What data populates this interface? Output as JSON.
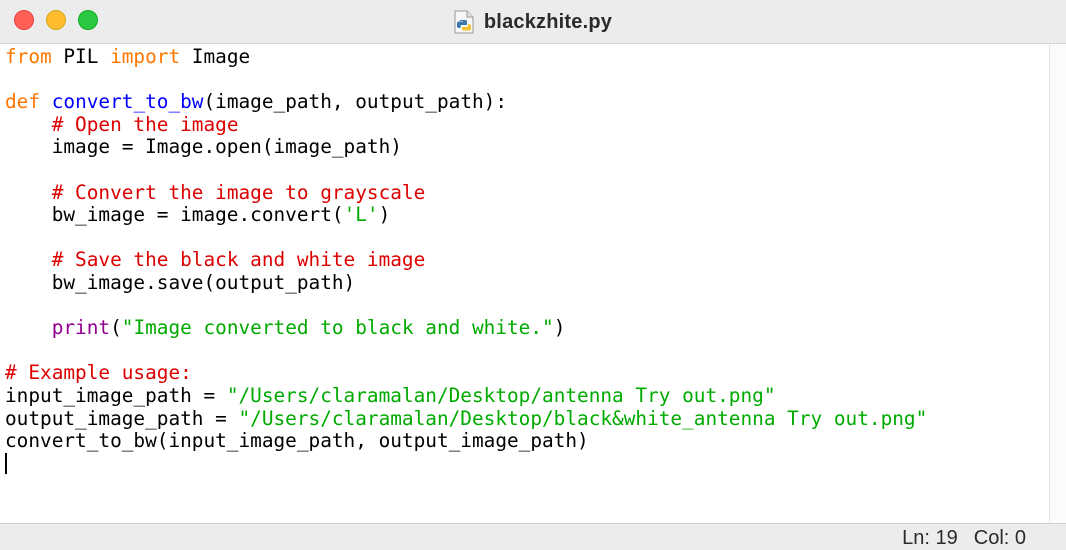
{
  "window": {
    "title": "blackzhite.py",
    "file_icon": "python-file-icon"
  },
  "editor": {
    "lines": [
      [
        {
          "t": "from",
          "c": "kw"
        },
        {
          "t": " PIL "
        },
        {
          "t": "import",
          "c": "kw"
        },
        {
          "t": " Image"
        }
      ],
      [],
      [
        {
          "t": "def",
          "c": "kw"
        },
        {
          "t": " "
        },
        {
          "t": "convert_to_bw",
          "c": "fn"
        },
        {
          "t": "(image_path, output_path):"
        }
      ],
      [
        {
          "t": "    "
        },
        {
          "t": "# Open the image",
          "c": "cm"
        }
      ],
      [
        {
          "t": "    image = Image.open(image_path)"
        }
      ],
      [],
      [
        {
          "t": "    "
        },
        {
          "t": "# Convert the image to grayscale",
          "c": "cm"
        }
      ],
      [
        {
          "t": "    bw_image = image.convert("
        },
        {
          "t": "'L'",
          "c": "st"
        },
        {
          "t": ")"
        }
      ],
      [],
      [
        {
          "t": "    "
        },
        {
          "t": "# Save the black and white image",
          "c": "cm"
        }
      ],
      [
        {
          "t": "    bw_image.save(output_path)"
        }
      ],
      [],
      [
        {
          "t": "    "
        },
        {
          "t": "print",
          "c": "bi"
        },
        {
          "t": "("
        },
        {
          "t": "\"Image converted to black and white.\"",
          "c": "st"
        },
        {
          "t": ")"
        }
      ],
      [],
      [
        {
          "t": "# Example usage:",
          "c": "cm"
        }
      ],
      [
        {
          "t": "input_image_path = "
        },
        {
          "t": "\"/Users/claramalan/Desktop/antenna Try out.png\"",
          "c": "st"
        }
      ],
      [
        {
          "t": "output_image_path = "
        },
        {
          "t": "\"/Users/claramalan/Desktop/black&white_antenna Try out.png\"",
          "c": "st"
        }
      ],
      [
        {
          "t": "convert_to_bw(input_image_path, output_image_path)"
        }
      ],
      []
    ],
    "cursor_line": 19
  },
  "status": {
    "line": "Ln: 19",
    "col": "Col: 0"
  },
  "colors": {
    "keyword": "#ff7700",
    "function_name": "#0000ff",
    "comment": "#dd0000",
    "string": "#00aa00",
    "builtin": "#900090",
    "close": "#fe5f57",
    "minimize": "#febc2e",
    "maximize": "#28c840"
  }
}
